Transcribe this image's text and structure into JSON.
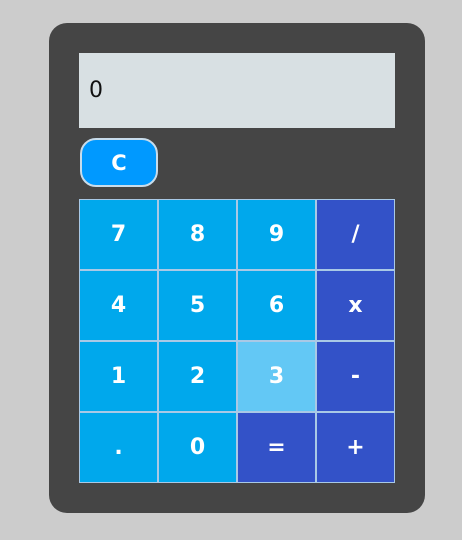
{
  "display": {
    "value": "0"
  },
  "clear_label": "C",
  "keys": {
    "k7": "7",
    "k8": "8",
    "k9": "9",
    "div": "/",
    "k4": "4",
    "k5": "5",
    "k6": "6",
    "mul": "x",
    "k1": "1",
    "k2": "2",
    "k3": "3",
    "sub": "-",
    "dot": ".",
    "k0": "0",
    "eq": "=",
    "add": "+"
  },
  "colors": {
    "background": "#cccccc",
    "body": "#454545",
    "display": "#d8e0e3",
    "clear_button": "#0099ff",
    "number_key": "#00a8ec",
    "operator_key": "#3352c8",
    "hovered_key": "#63c8f5"
  }
}
